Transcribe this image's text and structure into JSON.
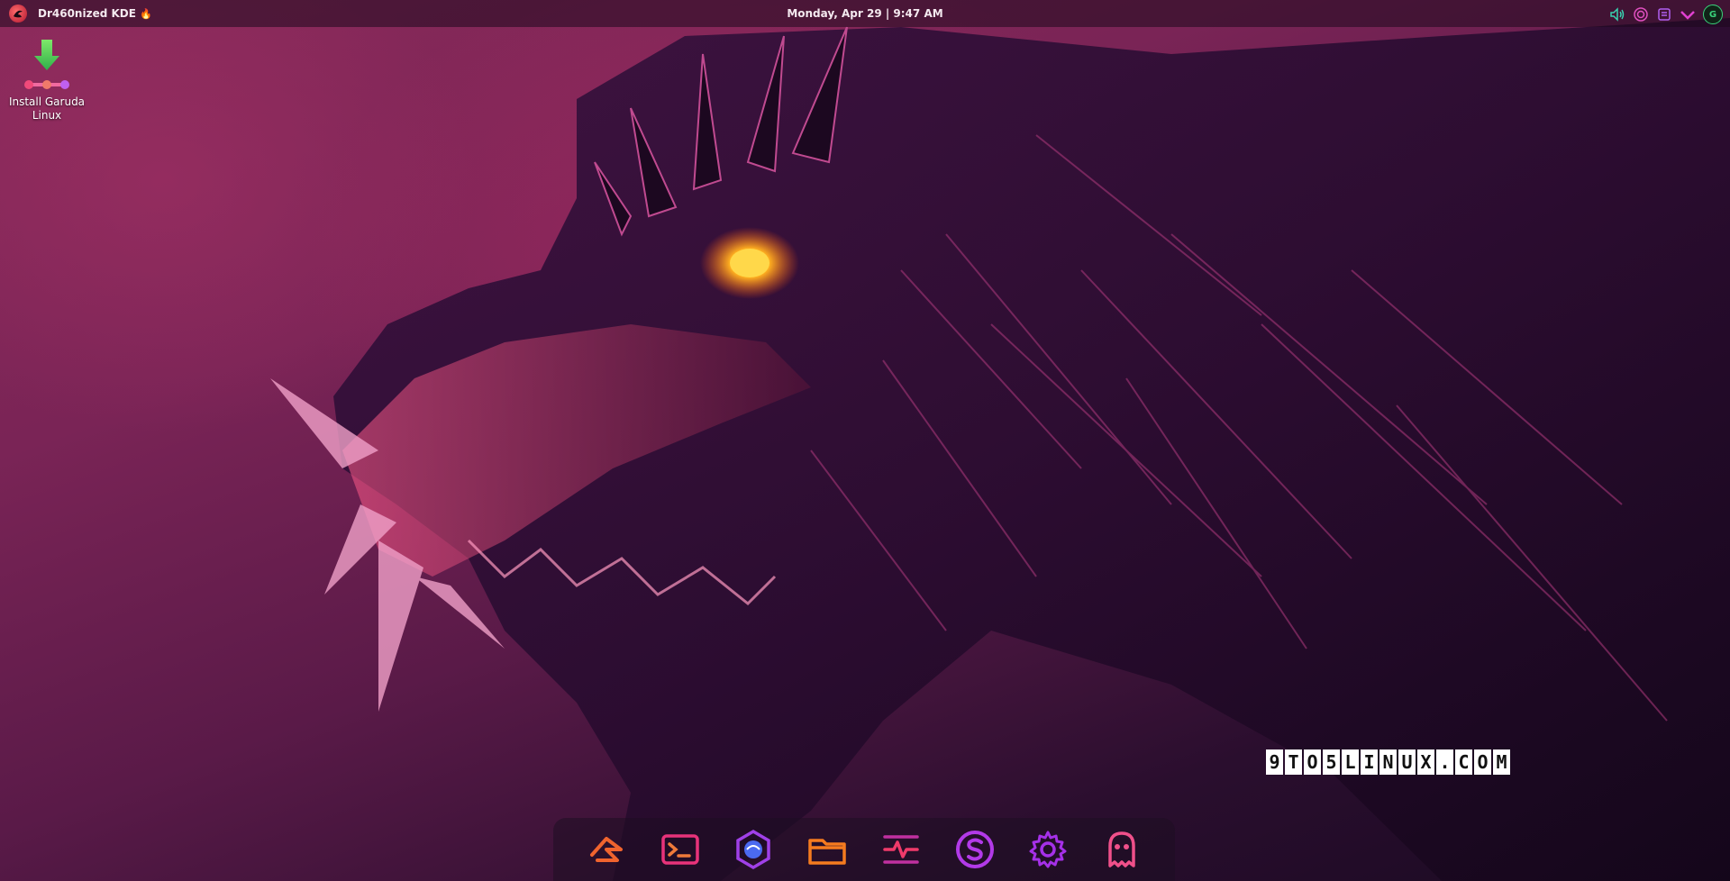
{
  "top_panel": {
    "window_title": "Dr460nized KDE",
    "title_emoji": "🔥",
    "clock": "Monday, Apr 29 | 9:47 AM",
    "avatar_letter": "G"
  },
  "desktop_icons": [
    {
      "label": "Install Garuda Linux"
    }
  ],
  "watermark": {
    "chars": [
      "9",
      "T",
      "O",
      "5",
      "L",
      "I",
      "N",
      "U",
      "X",
      ".",
      "C",
      "O",
      "M"
    ]
  },
  "dock": {
    "items": [
      {
        "icon": "garuda-welcome-icon",
        "color": "#f0642e"
      },
      {
        "icon": "terminal-icon",
        "color": "#e8337a"
      },
      {
        "icon": "garuda-browser-icon",
        "color": "#4b6af0"
      },
      {
        "icon": "file-manager-icon",
        "color": "#f57b1f"
      },
      {
        "icon": "system-monitor-icon",
        "color": "#e0307a"
      },
      {
        "icon": "software-store-icon",
        "color": "#b23ae8"
      },
      {
        "icon": "settings-icon",
        "color": "#a530e8"
      },
      {
        "icon": "ghost-app-icon",
        "color": "#f0508a"
      }
    ]
  },
  "colors": {
    "accent": "#e8337a",
    "panel_text": "#f4e9ef",
    "status_green": "#39d27a"
  }
}
